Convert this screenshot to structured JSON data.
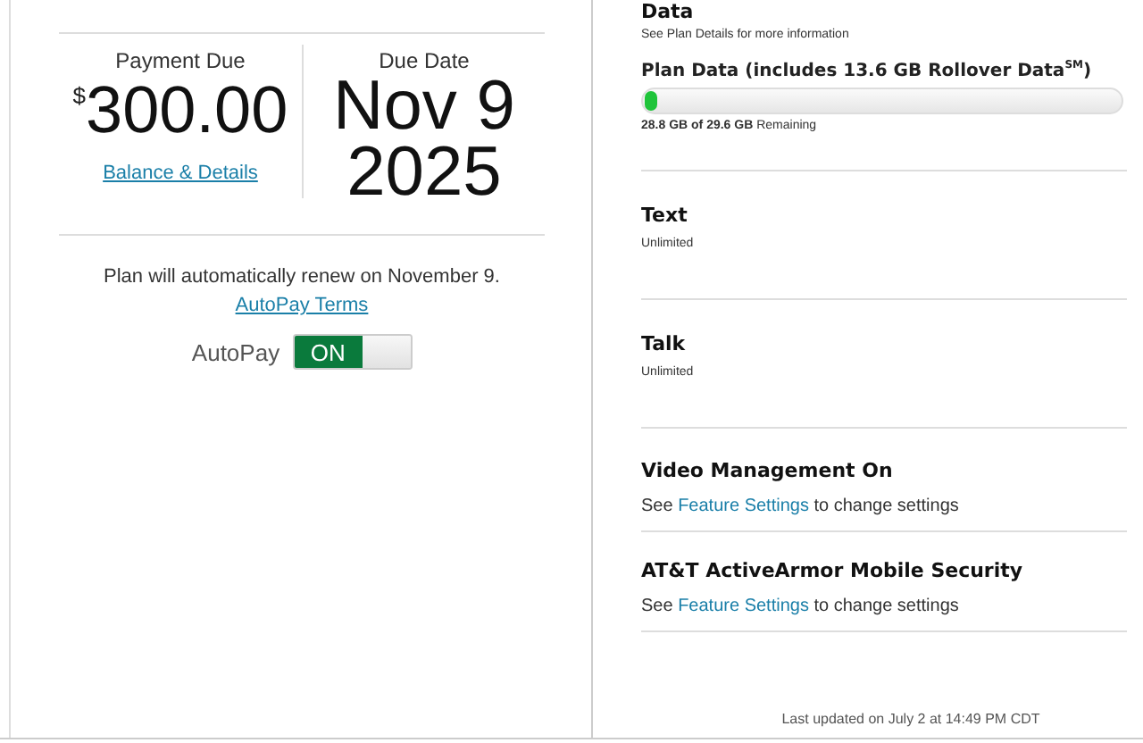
{
  "payment": {
    "label": "Payment Due",
    "currency": "$",
    "amount": "300.00",
    "link": "Balance & Details"
  },
  "due_date": {
    "label": "Due Date",
    "line_1": "Nov 9",
    "line_2": "2025"
  },
  "renewal": {
    "text": "Plan will automatically renew on November 9.",
    "terms_link": "AutoPay Terms"
  },
  "autopay": {
    "label": "AutoPay",
    "on": true,
    "on_text": "ON"
  },
  "sections": [
    {
      "kind": "data",
      "title": "Data",
      "note": "See Plan Details for more information",
      "meter_title": "Plan Data (includes 13.6 GB Rollover Data$^{SM}$)",
      "level": 0.02,
      "reading": "**28.8 GB of 29.6 GB** Remaining"
    },
    {
      "kind": "plain",
      "title": "Text",
      "note": "Unlimited"
    },
    {
      "kind": "plain",
      "title": "Talk",
      "note": "Unlimited"
    },
    {
      "kind": "link",
      "title": "Video Management On",
      "before": "See",
      "link": "Feature Settings",
      "after": "to change settings"
    },
    {
      "kind": "link",
      "title": "AT&T ActiveArmor Mobile Security",
      "before": "See",
      "link": "Feature Settings",
      "after": "to change settings"
    }
  ],
  "footer": "Last updated on July 2 at 14:49 PM CDT"
}
